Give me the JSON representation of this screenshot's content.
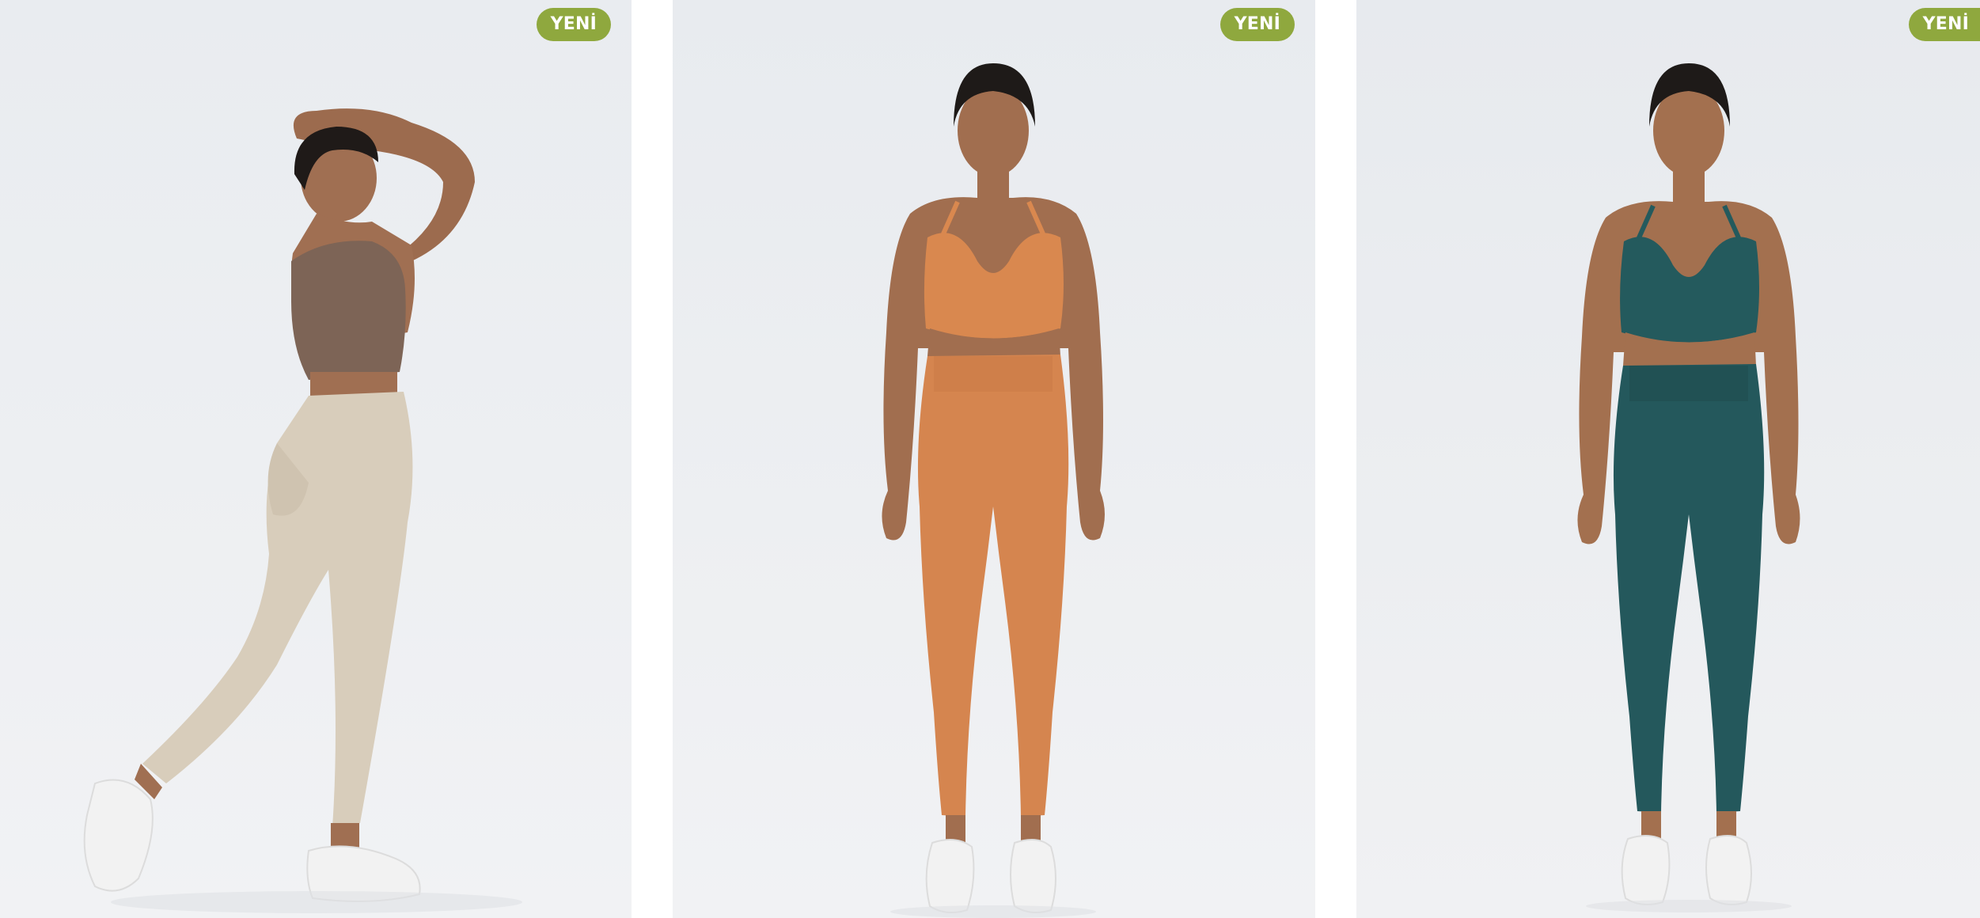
{
  "colors": {
    "badge_bg": "#8fa83e",
    "photo_bg": "#eceef1",
    "page_bg": "#ffffff"
  },
  "products": [
    {
      "badge": "YENİ",
      "photo": {
        "pose": "back",
        "top_color": "#7d6456",
        "bottom_color": "#d8cdbb",
        "shoe_color": "#f2f2f2"
      }
    },
    {
      "badge": "YENİ",
      "photo": {
        "pose": "front",
        "top_color": "#d9884f",
        "bottom_color": "#d5854f",
        "shoe_color": "#f2f2f2"
      }
    },
    {
      "badge": "YENİ",
      "photo": {
        "pose": "front",
        "top_color": "#245a5d",
        "bottom_color": "#24585c",
        "shoe_color": "#f2f2f2"
      }
    }
  ]
}
